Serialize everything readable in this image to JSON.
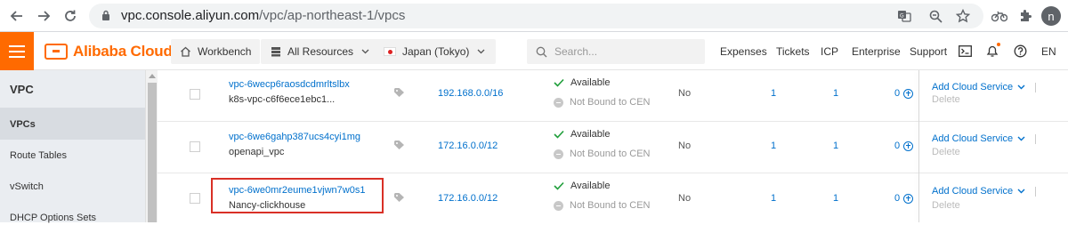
{
  "browser": {
    "url_host": "vpc.console.aliyun.com",
    "url_path": "/vpc/ap-northeast-1/vpcs",
    "profile_initial": "n"
  },
  "topbar": {
    "brand": "Alibaba Cloud",
    "workbench": "Workbench",
    "all_resources": "All Resources",
    "region": "Japan (Tokyo)",
    "search_placeholder": "Search...",
    "links": [
      "Expenses",
      "Tickets",
      "ICP",
      "Enterprise",
      "Support"
    ],
    "language": "EN"
  },
  "sidebar": {
    "title": "VPC",
    "items": [
      {
        "label": "VPCs",
        "active": true
      },
      {
        "label": "Route Tables",
        "active": false
      },
      {
        "label": "vSwitch",
        "active": false
      },
      {
        "label": "DHCP Options Sets",
        "active": false
      }
    ]
  },
  "colors": {
    "brand": "#ff6a00",
    "link": "#0070cc",
    "available": "#1f9e3a",
    "highlight_box": "#d93026"
  },
  "rows": [
    {
      "id": "vpc-6wecp6raosdcdmrltslbx",
      "name": "k8s-vpc-c6f6ece1ebc1...",
      "cidr": "192.168.0.0/16",
      "status": "Available",
      "cen": "Not Bound to CEN",
      "default": "No",
      "route_tables": "1",
      "vswitches": "1",
      "resources": "0",
      "action": "Add Cloud Service",
      "delete": "Delete"
    },
    {
      "id": "vpc-6we6gahp387ucs4cyi1mg",
      "name": "openapi_vpc",
      "cidr": "172.16.0.0/12",
      "status": "Available",
      "cen": "Not Bound to CEN",
      "default": "No",
      "route_tables": "1",
      "vswitches": "1",
      "resources": "0",
      "action": "Add Cloud Service",
      "delete": "Delete"
    },
    {
      "id": "vpc-6we0mr2eume1vjwn7w0s1",
      "name": "Nancy-clickhouse",
      "cidr": "172.16.0.0/12",
      "status": "Available",
      "cen": "Not Bound to CEN",
      "default": "No",
      "route_tables": "1",
      "vswitches": "1",
      "resources": "0",
      "action": "Add Cloud Service",
      "delete": "Delete"
    }
  ]
}
